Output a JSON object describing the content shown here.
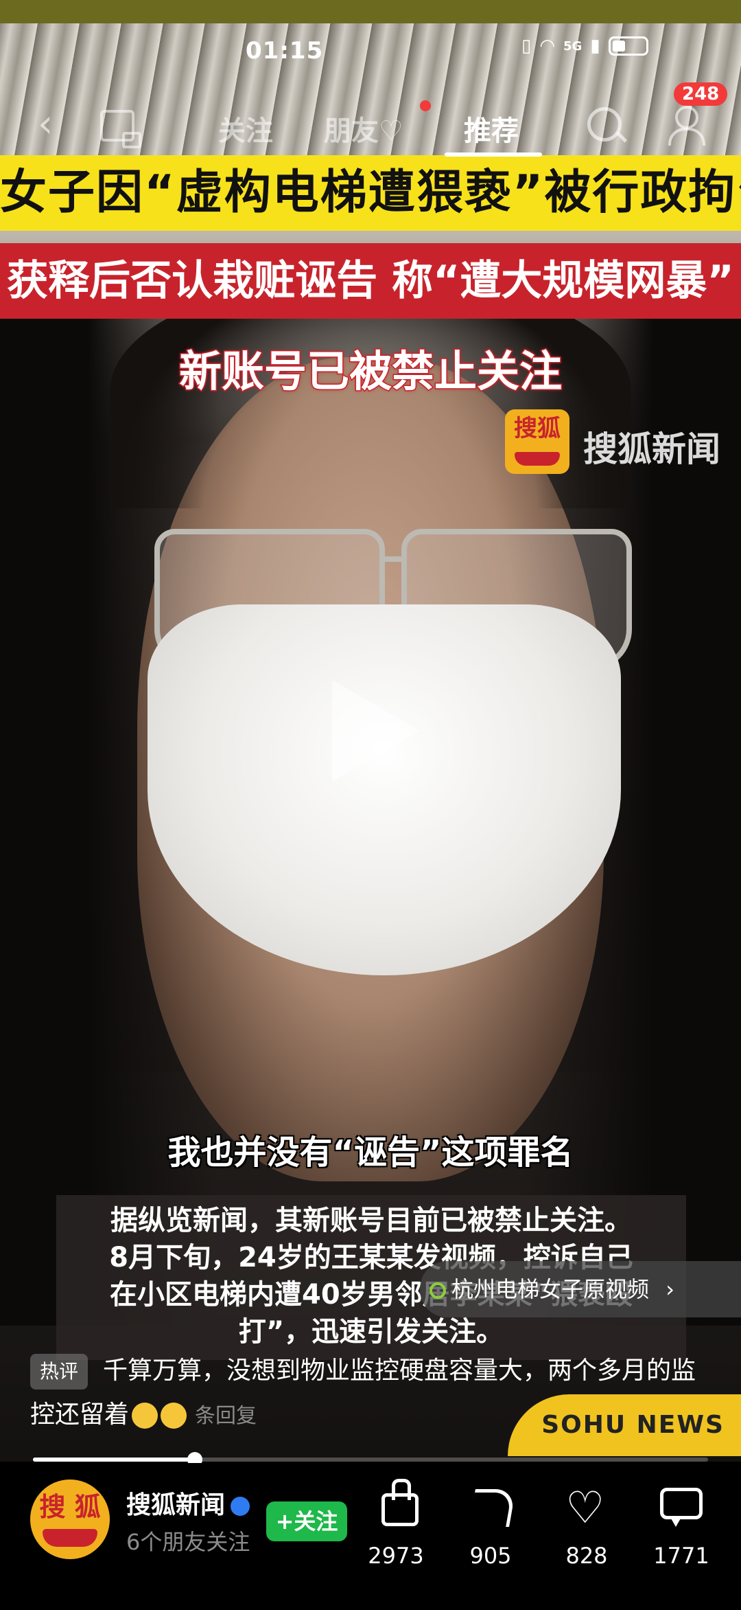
{
  "status_bar": {
    "time": "01:15",
    "network": "5G"
  },
  "nav": {
    "tabs": [
      {
        "label": "关注"
      },
      {
        "label": "朋友♡"
      },
      {
        "label": "推荐"
      }
    ],
    "notification_count": "248"
  },
  "video": {
    "headline1": "女子因“虚构电梯遭猥亵”被行政拘留",
    "headline2": "获释后否认栽赃诬告 称“遭大规模网暴”",
    "headline3": "新账号已被禁止关注",
    "watermark_logo": "搜狐",
    "watermark_text": "搜狐新闻",
    "subtitle": "我也并没有“诬告”这项罪名",
    "news_lines": [
      "据纵览新闻，其新账号目前已被禁止关注。",
      "8月下旬，24岁的王某某发视频，控诉自己",
      "在小区电梯内遭40岁男邻居李某某“猥亵殴",
      "打”，迅速引发关注。"
    ],
    "sohu_news": "SOHU NEWS",
    "progress": 0.24
  },
  "related": {
    "label": "杭州电梯女子原视频",
    "chevron": "›"
  },
  "hot_comment": {
    "tag": "热评",
    "text": "千算万算，没想到物业监控硬盘容量大，两个多月的监控还留着",
    "replies": "条回复"
  },
  "account": {
    "logo": "搜 狐",
    "name": "搜狐新闻",
    "sub": "6个朋友关注",
    "follow_label": "+关注"
  },
  "actions": {
    "likes": "2973",
    "shares": "905",
    "favorites": "828",
    "comments": "1771"
  }
}
